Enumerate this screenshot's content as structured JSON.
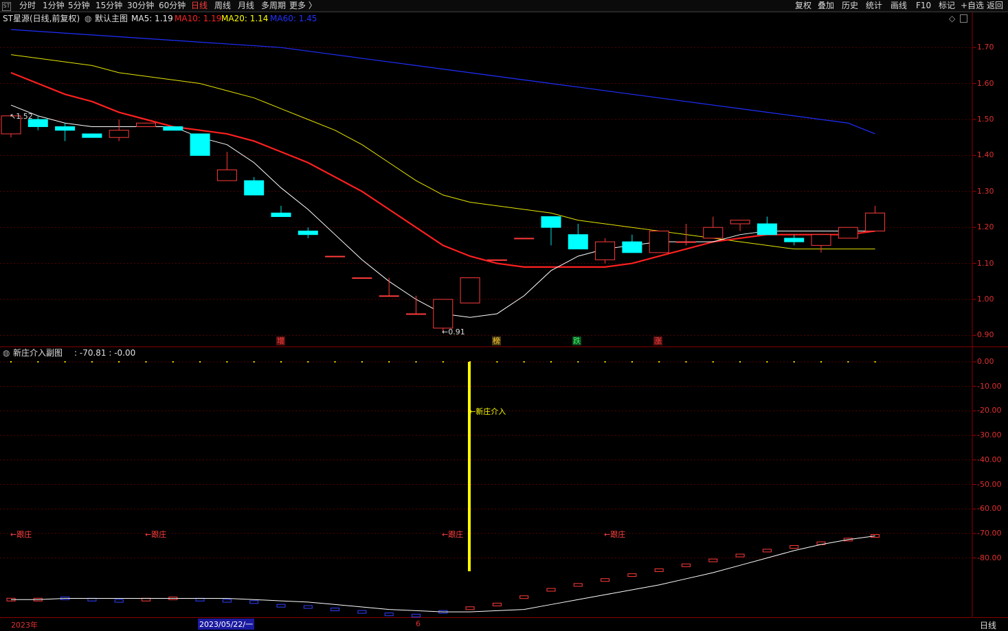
{
  "toolbar": {
    "app_icon": "ST",
    "periods": [
      "分时",
      "1分钟",
      "5分钟",
      "15分钟",
      "30分钟",
      "60分钟",
      "日线",
      "周线",
      "月线",
      "多周期",
      "更多 〉"
    ],
    "active_period": "日线",
    "actions": [
      "复权",
      "叠加",
      "历史",
      "统计",
      "画线",
      "F10",
      "标记",
      "+自选",
      "返回"
    ]
  },
  "main_chart": {
    "title": "ST星源(日线,前复权)",
    "template": "默认主图",
    "ma": [
      {
        "label": "MA5: 1.19",
        "color": "#ffffff"
      },
      {
        "label": "MA10: 1.19",
        "color": "#ff2020"
      },
      {
        "label": "MA20: 1.14",
        "color": "#ffff00"
      },
      {
        "label": "MA60: 1.45",
        "color": "#2030ff"
      }
    ],
    "price_scale": [
      "1.70",
      "1.60",
      "1.50",
      "1.40",
      "1.30",
      "1.20",
      "1.10",
      "1.00",
      "0.90"
    ],
    "high_label": "1.52",
    "low_label": "←0.91",
    "signals": [
      {
        "text": "增",
        "color": "#ff4040",
        "bg": "#5a1010"
      },
      {
        "text": "榜",
        "color": "#ffcc33",
        "bg": "#4a3a10"
      },
      {
        "text": "跌",
        "color": "#33ff66",
        "bg": "#104a20"
      },
      {
        "text": "涨",
        "color": "#ff4040",
        "bg": "#5a1010"
      }
    ],
    "candles": [
      {
        "o": 1.46,
        "h": 1.51,
        "l": 1.45,
        "c": 1.51
      },
      {
        "o": 1.5,
        "h": 1.51,
        "l": 1.47,
        "c": 1.48
      },
      {
        "o": 1.48,
        "h": 1.49,
        "l": 1.44,
        "c": 1.47
      },
      {
        "o": 1.46,
        "h": 1.46,
        "l": 1.45,
        "c": 1.45
      },
      {
        "o": 1.45,
        "h": 1.5,
        "l": 1.44,
        "c": 1.47
      },
      {
        "o": 1.48,
        "h": 1.49,
        "l": 1.48,
        "c": 1.49
      },
      {
        "o": 1.48,
        "h": 1.48,
        "l": 1.47,
        "c": 1.47
      },
      {
        "o": 1.46,
        "h": 1.46,
        "l": 1.4,
        "c": 1.4
      },
      {
        "o": 1.33,
        "h": 1.41,
        "l": 1.33,
        "c": 1.36
      },
      {
        "o": 1.33,
        "h": 1.34,
        "l": 1.29,
        "c": 1.29
      },
      {
        "o": 1.24,
        "h": 1.26,
        "l": 1.23,
        "c": 1.23
      },
      {
        "o": 1.19,
        "h": 1.2,
        "l": 1.17,
        "c": 1.18
      },
      {
        "o": 1.12,
        "h": 1.12,
        "l": 1.12,
        "c": 1.12
      },
      {
        "o": 1.06,
        "h": 1.06,
        "l": 1.06,
        "c": 1.06
      },
      {
        "o": 1.01,
        "h": 1.06,
        "l": 1.01,
        "c": 1.01
      },
      {
        "o": 0.96,
        "h": 1.01,
        "l": 0.96,
        "c": 0.96
      },
      {
        "o": 0.92,
        "h": 1.0,
        "l": 0.91,
        "c": 1.0
      },
      {
        "o": 0.99,
        "h": 1.06,
        "l": 0.99,
        "c": 1.06
      },
      {
        "o": 1.11,
        "h": 1.11,
        "l": 1.11,
        "c": 1.11
      },
      {
        "o": 1.17,
        "h": 1.17,
        "l": 1.17,
        "c": 1.17
      },
      {
        "o": 1.23,
        "h": 1.23,
        "l": 1.15,
        "c": 1.2
      },
      {
        "o": 1.18,
        "h": 1.21,
        "l": 1.14,
        "c": 1.14
      },
      {
        "o": 1.11,
        "h": 1.17,
        "l": 1.1,
        "c": 1.16
      },
      {
        "o": 1.16,
        "h": 1.18,
        "l": 1.13,
        "c": 1.13
      },
      {
        "o": 1.13,
        "h": 1.19,
        "l": 1.13,
        "c": 1.19
      },
      {
        "o": 1.16,
        "h": 1.21,
        "l": 1.15,
        "c": 1.16
      },
      {
        "o": 1.17,
        "h": 1.23,
        "l": 1.17,
        "c": 1.2
      },
      {
        "o": 1.21,
        "h": 1.22,
        "l": 1.19,
        "c": 1.22
      },
      {
        "o": 1.21,
        "h": 1.23,
        "l": 1.18,
        "c": 1.18
      },
      {
        "o": 1.17,
        "h": 1.18,
        "l": 1.15,
        "c": 1.16
      },
      {
        "o": 1.15,
        "h": 1.18,
        "l": 1.13,
        "c": 1.18
      },
      {
        "o": 1.17,
        "h": 1.2,
        "l": 1.17,
        "c": 1.2
      },
      {
        "o": 1.19,
        "h": 1.26,
        "l": 1.19,
        "c": 1.24
      }
    ],
    "ma5": [
      1.54,
      1.51,
      1.49,
      1.48,
      1.48,
      1.48,
      1.48,
      1.45,
      1.43,
      1.38,
      1.31,
      1.25,
      1.18,
      1.11,
      1.05,
      1.0,
      0.96,
      0.95,
      0.96,
      1.01,
      1.08,
      1.12,
      1.14,
      1.15,
      1.16,
      1.16,
      1.16,
      1.18,
      1.19,
      1.19,
      1.19,
      1.19,
      1.19
    ],
    "ma10": [
      1.63,
      1.6,
      1.57,
      1.55,
      1.52,
      1.5,
      1.48,
      1.47,
      1.46,
      1.44,
      1.41,
      1.38,
      1.34,
      1.3,
      1.25,
      1.2,
      1.15,
      1.12,
      1.1,
      1.09,
      1.09,
      1.09,
      1.09,
      1.1,
      1.12,
      1.14,
      1.16,
      1.17,
      1.18,
      1.18,
      1.18,
      1.18,
      1.19
    ],
    "ma20": [
      1.68,
      1.67,
      1.66,
      1.65,
      1.63,
      1.62,
      1.61,
      1.6,
      1.58,
      1.56,
      1.53,
      1.5,
      1.47,
      1.43,
      1.38,
      1.33,
      1.29,
      1.27,
      1.26,
      1.25,
      1.24,
      1.22,
      1.21,
      1.2,
      1.19,
      1.18,
      1.17,
      1.16,
      1.15,
      1.14,
      1.14,
      1.14,
      1.14
    ],
    "ma60": [
      1.75,
      1.745,
      1.74,
      1.735,
      1.73,
      1.725,
      1.72,
      1.715,
      1.71,
      1.705,
      1.7,
      1.69,
      1.68,
      1.67,
      1.66,
      1.65,
      1.64,
      1.63,
      1.62,
      1.61,
      1.6,
      1.59,
      1.58,
      1.57,
      1.56,
      1.55,
      1.54,
      1.53,
      1.52,
      1.51,
      1.5,
      1.49,
      1.46
    ]
  },
  "sub_chart": {
    "title": "新庄介入副图",
    "values": ": -70.81 : -0.00",
    "scale": [
      "0.00",
      "-10.00",
      "-20.00",
      "-30.00",
      "-40.00",
      "-50.00",
      "-60.00",
      "-70.00",
      "-80.00"
    ],
    "marker_label": "←新庄介入",
    "follow_labels": [
      "←跟庄",
      "←跟庄",
      "←跟庄",
      "←跟庄"
    ],
    "bars": [
      -97,
      -97,
      -96.5,
      -97,
      -97.5,
      -97,
      -96.5,
      -97,
      -97.5,
      -98,
      -99.5,
      -100,
      -101,
      -102,
      -103,
      -103.5,
      -102,
      -100.5,
      -99,
      -96,
      -93,
      -91,
      -89,
      -87,
      -85,
      -83,
      -81,
      -79,
      -77,
      -75.5,
      -74,
      -72.5,
      -71
    ],
    "bar_up": [
      true,
      true,
      false,
      false,
      false,
      true,
      true,
      false,
      false,
      false,
      false,
      false,
      false,
      false,
      false,
      false,
      false,
      true,
      true,
      true,
      true,
      true,
      true,
      true,
      true,
      true,
      true,
      true,
      true,
      true,
      true,
      true,
      true
    ],
    "white_line": [
      -97,
      -97,
      -96.5,
      -96.5,
      -96.5,
      -96.5,
      -96.5,
      -96.5,
      -96.5,
      -97,
      -97.5,
      -98,
      -99,
      -100,
      -101,
      -101.5,
      -102,
      -102,
      -101.5,
      -101,
      -99,
      -97,
      -95,
      -93,
      -91,
      -88.5,
      -86,
      -83,
      -80,
      -77,
      -74.5,
      -72.5,
      -71
    ]
  },
  "bottom_bar": {
    "year": "2023年",
    "date": "2023/05/22/一",
    "month": "6",
    "period_tab": "日线"
  }
}
